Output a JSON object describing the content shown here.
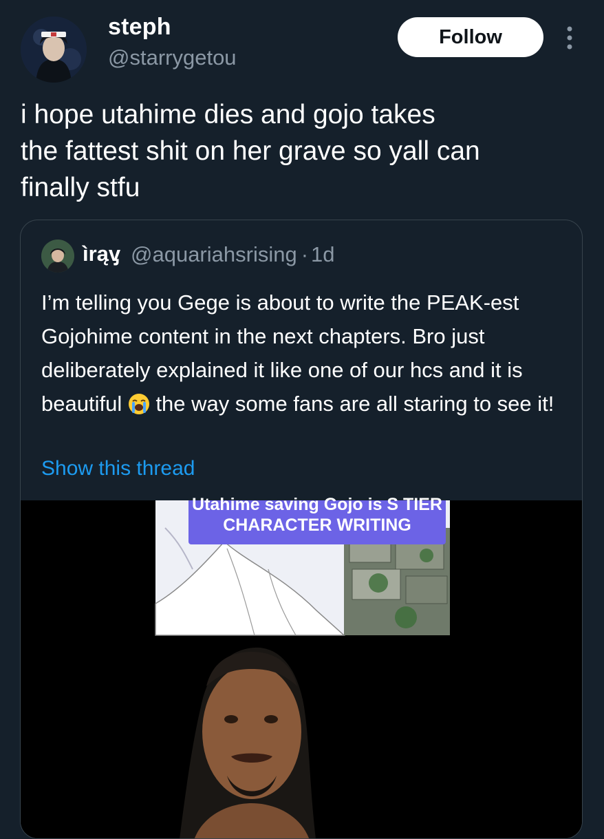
{
  "author": {
    "display_name": "steph",
    "handle": "@starrygetou"
  },
  "actions": {
    "follow_label": "Follow"
  },
  "tweet": {
    "text": "i hope utahime dies and gojo takes\nthe fattest shit on her grave so yall can\nfinally stfu"
  },
  "quoted": {
    "display_name": "ìrąᶌ",
    "handle": "@aquariahsrising",
    "separator": "·",
    "time": "1d",
    "text_before_emoji": "I’m telling you Gege is about to write the PEAK-est Gojohime content in the next chapters. Bro just deliberately explained it like one of our hcs and it is beautiful ",
    "text_after_emoji": " the way some fans are all staring to see it!",
    "emoji": "loudly-crying-face",
    "show_thread": "Show this thread",
    "media_caption_line1": "Utahime saving Gojo is S TIER",
    "media_caption_line2": "CHARACTER WRITING"
  },
  "colors": {
    "background": "#15202b",
    "accent": "#1d9bf0",
    "muted": "#8b98a5",
    "border": "#38444d",
    "caption_bg": "#6c63e6"
  }
}
